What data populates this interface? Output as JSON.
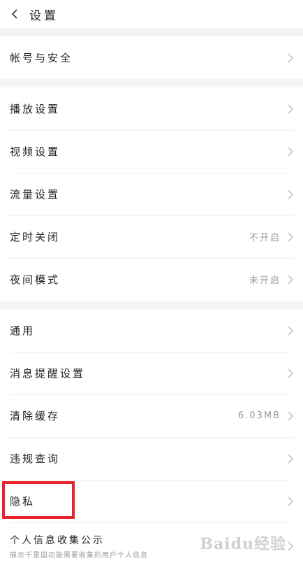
{
  "header": {
    "title": "设置"
  },
  "groups": [
    {
      "items": [
        {
          "label": "帐号与安全",
          "value": ""
        }
      ]
    },
    {
      "items": [
        {
          "label": "播放设置",
          "value": ""
        },
        {
          "label": "视频设置",
          "value": ""
        },
        {
          "label": "流量设置",
          "value": ""
        },
        {
          "label": "定时关闭",
          "value": "不开启"
        },
        {
          "label": "夜间模式",
          "value": "未开启"
        }
      ]
    },
    {
      "items": [
        {
          "label": "通用",
          "value": ""
        },
        {
          "label": "消息提醒设置",
          "value": ""
        },
        {
          "label": "清除缓存",
          "value": "6.03MB"
        },
        {
          "label": "违规查询",
          "value": ""
        },
        {
          "label": "隐私",
          "value": ""
        },
        {
          "label": "个人信息收集公示",
          "sub": "展示千里国功能需要收集的用户个人信息",
          "value": ""
        }
      ]
    }
  ],
  "colors": {
    "highlight": "#e8232b",
    "divider_bg": "#f2f4f6"
  },
  "watermark": {
    "text": "Baidu经验"
  }
}
